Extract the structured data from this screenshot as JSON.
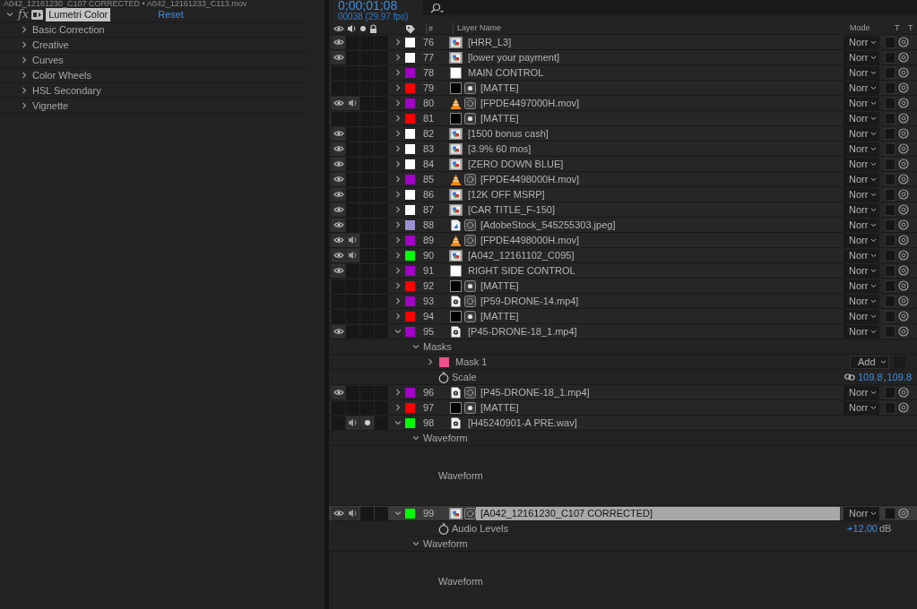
{
  "effect_controls": {
    "title": "A042_12161230_C107 CORRECTED • A042_12161233_C113.mov",
    "effect": {
      "badge": "fx",
      "name": "Lumetri Color",
      "expanded": true,
      "reset": "Reset"
    },
    "groups": [
      {
        "label": "Basic Correction",
        "expanded": false
      },
      {
        "label": "Creative",
        "expanded": false
      },
      {
        "label": "Curves",
        "expanded": false
      },
      {
        "label": "Color Wheels",
        "expanded": false
      },
      {
        "label": "HSL Secondary",
        "expanded": false
      },
      {
        "label": "Vignette",
        "expanded": false
      }
    ]
  },
  "timeline": {
    "timecode": "0;00;01;08",
    "frame_info": "00038 (29.97 fps)",
    "columns": {
      "number": "#",
      "layer_name": "Layer Name",
      "mode": "Mode",
      "col_t": "T",
      "col_t2": "T"
    },
    "layers": [
      {
        "number": "76",
        "name": "[HRR_L3]",
        "color": "#ffffff",
        "video": true,
        "audio": false,
        "solo": false,
        "expanded": false,
        "selected": false,
        "source": {
          "kind": "footage"
        },
        "mode": "Norr",
        "preserve_transparency": false
      },
      {
        "number": "77",
        "name": "[lower your payment]",
        "color": "#ffffff",
        "video": true,
        "audio": false,
        "solo": false,
        "expanded": false,
        "selected": false,
        "source": {
          "kind": "footage"
        },
        "mode": "Norr",
        "preserve_transparency": false
      },
      {
        "number": "78",
        "name": "MAIN CONTROL",
        "color": "#a200c8",
        "video": false,
        "audio": false,
        "solo": false,
        "expanded": false,
        "selected": false,
        "source": {
          "kind": "solid",
          "color": "#ffffff"
        },
        "mode": "Norr",
        "preserve_transparency": false
      },
      {
        "number": "79",
        "name": "[MATTE]",
        "color": "#ff0000",
        "video": false,
        "audio": false,
        "solo": false,
        "expanded": false,
        "selected": false,
        "source": {
          "kind": "solid",
          "color": "#000000"
        },
        "overlay": {
          "kind": "matte"
        },
        "mode": "Norr",
        "preserve_transparency": false
      },
      {
        "number": "80",
        "name": "[FPDE4497000H.mov]",
        "color": "#a200c8",
        "video": true,
        "audio": true,
        "solo": false,
        "expanded": false,
        "selected": false,
        "source": {
          "kind": "cone"
        },
        "overlay": {
          "kind": "precomp"
        },
        "mode": "Norr",
        "preserve_transparency": false
      },
      {
        "number": "81",
        "name": "[MATTE]",
        "color": "#ff0000",
        "video": false,
        "audio": false,
        "solo": false,
        "expanded": false,
        "selected": false,
        "source": {
          "kind": "solid",
          "color": "#000000"
        },
        "overlay": {
          "kind": "matte"
        },
        "mode": "Norr",
        "preserve_transparency": false
      },
      {
        "number": "82",
        "name": "[1500 bonus cash]",
        "color": "#ffffff",
        "video": true,
        "audio": false,
        "solo": false,
        "expanded": false,
        "selected": false,
        "source": {
          "kind": "footage"
        },
        "mode": "Norr",
        "preserve_transparency": false
      },
      {
        "number": "83",
        "name": "[3.9% 60 mos]",
        "color": "#ffffff",
        "video": true,
        "audio": false,
        "solo": false,
        "expanded": false,
        "selected": false,
        "source": {
          "kind": "footage"
        },
        "mode": "Norr",
        "preserve_transparency": false
      },
      {
        "number": "84",
        "name": "[ZERO DOWN BLUE]",
        "color": "#ffffff",
        "video": true,
        "audio": false,
        "solo": false,
        "expanded": false,
        "selected": false,
        "source": {
          "kind": "footage"
        },
        "mode": "Norr",
        "preserve_transparency": false
      },
      {
        "number": "85",
        "name": "[FPDE4498000H.mov]",
        "color": "#a200c8",
        "video": true,
        "audio": false,
        "solo": false,
        "expanded": false,
        "selected": false,
        "source": {
          "kind": "cone"
        },
        "overlay": {
          "kind": "precomp"
        },
        "mode": "Norr",
        "preserve_transparency": false
      },
      {
        "number": "86",
        "name": "[12K OFF MSRP]",
        "color": "#ffffff",
        "video": true,
        "audio": false,
        "solo": false,
        "expanded": false,
        "selected": false,
        "source": {
          "kind": "footage"
        },
        "mode": "Norr",
        "preserve_transparency": false
      },
      {
        "number": "87",
        "name": "[CAR TITLE_F-150]",
        "color": "#ffffff",
        "video": true,
        "audio": false,
        "solo": false,
        "expanded": false,
        "selected": false,
        "source": {
          "kind": "footage"
        },
        "mode": "Norr",
        "preserve_transparency": false
      },
      {
        "number": "88",
        "name": "[AdobeStock_545255303.jpeg]",
        "color": "#9a90d4",
        "video": true,
        "audio": false,
        "solo": false,
        "expanded": false,
        "selected": false,
        "source": {
          "kind": "image_file"
        },
        "overlay": {
          "kind": "precomp"
        },
        "mode": "Norr",
        "preserve_transparency": false
      },
      {
        "number": "89",
        "name": "[FPDE4498000H.mov]",
        "color": "#a200c8",
        "video": true,
        "audio": true,
        "solo": false,
        "expanded": false,
        "selected": false,
        "source": {
          "kind": "cone"
        },
        "overlay": {
          "kind": "precomp"
        },
        "mode": "Norr",
        "preserve_transparency": false
      },
      {
        "number": "90",
        "name": "[A042_12161102_C095]",
        "color": "#00ff00",
        "video": true,
        "audio": true,
        "solo": false,
        "expanded": false,
        "selected": false,
        "source": {
          "kind": "footage"
        },
        "mode": "Norr",
        "preserve_transparency": false
      },
      {
        "number": "91",
        "name": "RIGHT SIDE CONTROL",
        "color": "#a200c8",
        "video": true,
        "audio": false,
        "solo": false,
        "expanded": false,
        "selected": false,
        "source": {
          "kind": "solid",
          "color": "#ffffff"
        },
        "mode": "Norr",
        "preserve_transparency": false
      },
      {
        "number": "92",
        "name": "[MATTE]",
        "color": "#ff0000",
        "video": false,
        "audio": false,
        "solo": false,
        "expanded": false,
        "selected": false,
        "source": {
          "kind": "solid",
          "color": "#000000"
        },
        "overlay": {
          "kind": "matte"
        },
        "mode": "Norr",
        "preserve_transparency": false
      },
      {
        "number": "93",
        "name": "[P59-DRONE-14.mp4]",
        "color": "#a200c8",
        "video": false,
        "audio": false,
        "solo": false,
        "expanded": false,
        "selected": false,
        "source": {
          "kind": "media_file"
        },
        "overlay": {
          "kind": "precomp"
        },
        "mode": "Norr",
        "preserve_transparency": false
      },
      {
        "number": "94",
        "name": "[MATTE]",
        "color": "#ff0000",
        "video": false,
        "audio": false,
        "solo": false,
        "expanded": false,
        "selected": false,
        "source": {
          "kind": "solid",
          "color": "#000000"
        },
        "overlay": {
          "kind": "matte"
        },
        "mode": "Norr",
        "preserve_transparency": false
      },
      {
        "number": "95",
        "name": "[P45-DRONE-18_1.mp4]",
        "color": "#a200c8",
        "video": true,
        "audio": false,
        "solo": false,
        "expanded": true,
        "selected": false,
        "source": {
          "kind": "media_file"
        },
        "mode": "Norr",
        "preserve_transparency": false,
        "children": [
          {
            "kind": "group",
            "label": "Masks",
            "expanded": true,
            "children": [
              {
                "kind": "mask",
                "label": "Mask 1",
                "color": "#f0508c",
                "expanded": false,
                "mode": "Add",
                "inverted": false
              }
            ]
          },
          {
            "kind": "property",
            "label": "Scale",
            "linked": true,
            "value": "109.8",
            "separator": ",",
            "value_2": "109.8"
          }
        ]
      },
      {
        "number": "96",
        "name": "[P45-DRONE-18_1.mp4]",
        "color": "#a200c8",
        "video": true,
        "audio": false,
        "solo": false,
        "expanded": false,
        "selected": false,
        "source": {
          "kind": "media_file"
        },
        "overlay": {
          "kind": "precomp"
        },
        "mode": "Norr",
        "preserve_transparency": false
      },
      {
        "number": "97",
        "name": "[MATTE]",
        "color": "#ff0000",
        "video": false,
        "audio": false,
        "solo": false,
        "expanded": false,
        "selected": false,
        "source": {
          "kind": "solid",
          "color": "#000000"
        },
        "overlay": {
          "kind": "matte"
        },
        "mode": "Norr",
        "preserve_transparency": false
      },
      {
        "number": "98",
        "name": "[H45240901-A PRE.wav]",
        "color": "#00ff00",
        "video": false,
        "audio": true,
        "solo": true,
        "expanded": true,
        "selected": false,
        "source": {
          "kind": "media_file"
        },
        "children": [
          {
            "kind": "group",
            "label": "Waveform",
            "expanded": true,
            "children": [
              {
                "kind": "waveform",
                "label": "Waveform"
              }
            ]
          }
        ]
      },
      {
        "number": "99",
        "name": "[A042_12161230_C107 CORRECTED]",
        "color": "#00ff00",
        "video": true,
        "audio": true,
        "solo": false,
        "expanded": true,
        "selected": true,
        "source": {
          "kind": "footage"
        },
        "overlay": {
          "kind": "precomp"
        },
        "mode": "Norr",
        "preserve_transparency": false,
        "children": [
          {
            "kind": "property",
            "label": "Audio Levels",
            "value": "+12.00",
            "unit": "dB"
          },
          {
            "kind": "group",
            "label": "Waveform",
            "expanded": true,
            "children": [
              {
                "kind": "waveform",
                "label": "Waveform"
              }
            ]
          }
        ]
      }
    ]
  }
}
